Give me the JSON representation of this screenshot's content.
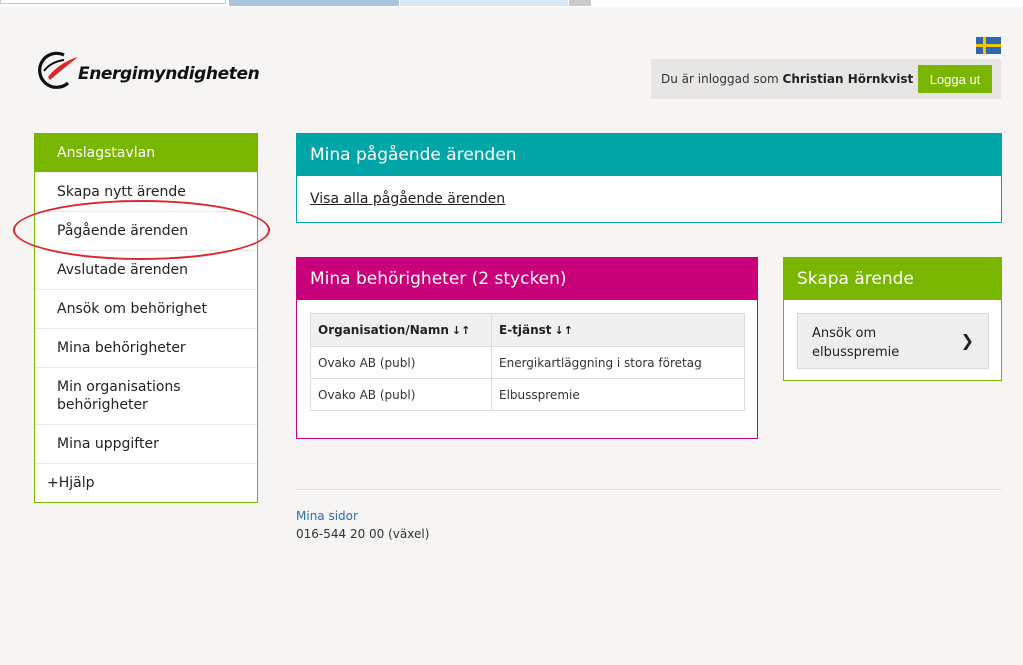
{
  "brand": {
    "name": "Energimyndigheten"
  },
  "header": {
    "logged_in_prefix": "Du är inloggad som",
    "user_name": "Christian Hörnkvist",
    "logout_label": "Logga ut",
    "flag_colors": {
      "blue": "#2f66b3",
      "yellow": "#f1c500"
    }
  },
  "sidebar": {
    "heading": "Anslagstavlan",
    "items": [
      {
        "label": "Skapa nytt ärende"
      },
      {
        "label": "Pågående ärenden"
      },
      {
        "label": "Avslutade ärenden"
      },
      {
        "label": "Ansök om behörighet"
      },
      {
        "label": "Mina behörigheter"
      },
      {
        "label": "Min organisations behörigheter"
      },
      {
        "label": "Mina uppgifter"
      },
      {
        "label": "Hjälp",
        "prefix": "+"
      }
    ]
  },
  "ongoing": {
    "title": "Mina pågående ärenden",
    "link": "Visa alla pågående ärenden"
  },
  "permissions": {
    "title": "Mina behörigheter (2 stycken)",
    "columns": [
      "Organisation/Namn",
      "E-tjänst"
    ],
    "rows": [
      [
        "Ovako AB (publ)",
        "Energikartläggning i stora företag"
      ],
      [
        "Ovako AB (publ)",
        "Elbusspremie"
      ]
    ]
  },
  "create_case": {
    "title": "Skapa ärende",
    "button_line1": "Ansök om",
    "button_line2": "elbusspremie"
  },
  "footer": {
    "link": "Mina sidor",
    "phone": "016-544 20 00 (växel)"
  },
  "colors": {
    "green": "#79b600",
    "teal": "#00a5a8",
    "magenta": "#c8007a",
    "highlight_circle": "#d9272e"
  }
}
